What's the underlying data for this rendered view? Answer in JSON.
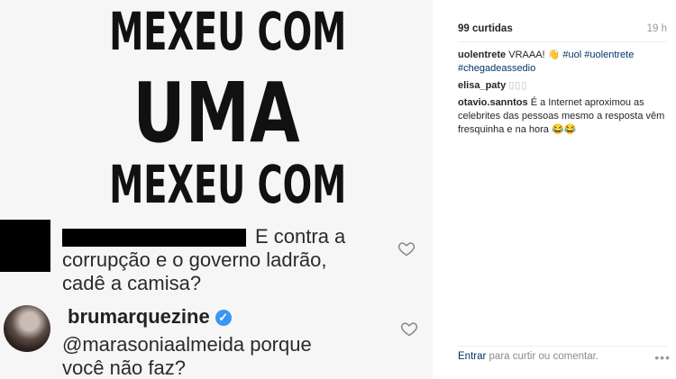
{
  "photo": {
    "headline": [
      "MEXEU COM",
      "UMA",
      "MEXEU COM"
    ],
    "comment1": {
      "text_line1": "E contra a",
      "text_line2": "corrupção e o governo ladrão,",
      "text_line3": "cadê a camisa?"
    },
    "comment2": {
      "username": "brumarquezine",
      "text_line1": "@marasoniaalmeida porque",
      "text_line2": "você não faz?"
    }
  },
  "post": {
    "likes": "99 curtidas",
    "time": "19 h",
    "caption": {
      "user": "uolentrete",
      "text": "VRAAA! 👋",
      "hashtags": [
        "#uol",
        "#uolentrete",
        "#chegadeassedio"
      ]
    },
    "comments": [
      {
        "user": "elisa_paty",
        "text": "▯▯▯"
      },
      {
        "user": "otavio.sanntos",
        "text": "É a Internet aproximou as celebrites das pessoas mesmo a resposta vêm fresquinha e na hora 😂😂"
      }
    ],
    "add_comment": {
      "login_label": "Entrar",
      "rest_label": "para curtir ou comentar."
    },
    "more_icon": "more-options-icon"
  },
  "colors": {
    "link": "#003569",
    "verified": "#3897f0",
    "muted": "#999999"
  }
}
